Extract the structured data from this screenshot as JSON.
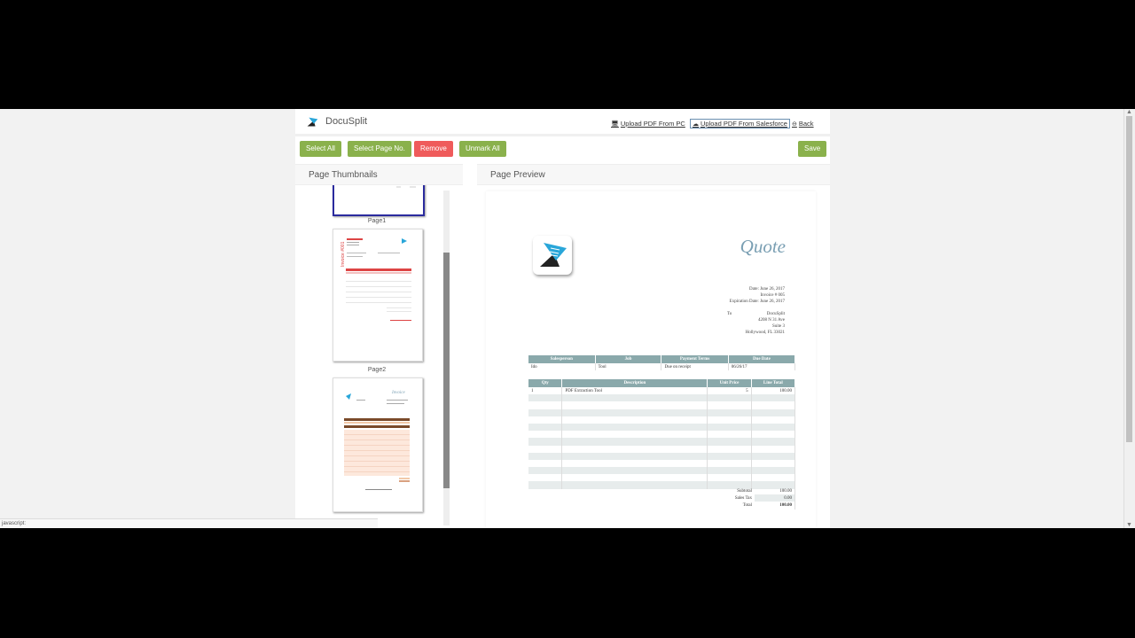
{
  "header": {
    "app_name": "DocuSplit",
    "upload_pc": "Upload PDF From PC",
    "upload_sf": "Upload PDF From Salesforce",
    "back": "Back"
  },
  "toolbar": {
    "select_all": "Select All",
    "select_page_no": "Select Page No.",
    "remove": "Remove",
    "unmark_all": "Unmark All",
    "save": "Save"
  },
  "left_panel": {
    "title": "Page Thumbnails",
    "pages": [
      {
        "label": "Page1"
      },
      {
        "label": "Page2"
      }
    ]
  },
  "right_panel": {
    "title": "Page Preview",
    "doc": {
      "title": "Quote",
      "date": "Date: June 26, 2017",
      "invoice": "Invoice # 005",
      "expiration": "Expiration Date: June 26, 2017",
      "to_label": "To",
      "to_lines": [
        "DocuSplit",
        "4208 N 31 Ave",
        "Suite 3",
        "Hollywood, FL 33021"
      ],
      "table1_headers": [
        "Salesperson",
        "Job",
        "Payment Terms",
        "Due Date"
      ],
      "table1_row": [
        "Ido",
        "Tool",
        "Due on receipt",
        "06/26/17"
      ],
      "table2_headers": [
        "Qty",
        "Description",
        "Unit Price",
        "Line Total"
      ],
      "table2_row": [
        "1",
        "PDF Extraction Tool",
        "5",
        "100.00"
      ],
      "subtotal_label": "Subtotal",
      "subtotal": "100.00",
      "tax_label": "Sales Tax",
      "tax": "0.00",
      "total_label": "Total",
      "total": "100.00"
    }
  },
  "status_bar": "javascript:",
  "colors": {
    "green": "#8ab14c",
    "red": "#ef5b5b",
    "table_header": "#8aa9ab",
    "quote_title": "#7a9fb3"
  }
}
